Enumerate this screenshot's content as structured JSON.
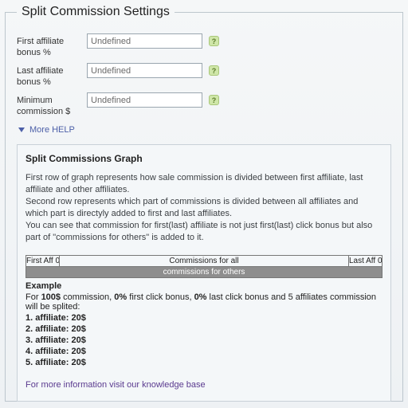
{
  "legend": "Split Commission Settings",
  "rows": {
    "first": {
      "label": "First affiliate bonus %",
      "value": "Undefined"
    },
    "last": {
      "label": "Last affiliate bonus %",
      "value": "Undefined"
    },
    "min": {
      "label": "Minimum commission $",
      "value": "Undefined"
    }
  },
  "help": {
    "more": "More HELP"
  },
  "panel": {
    "title": "Split Commissions Graph",
    "p1": "First row of graph represents how sale commission is divided between first affiliate, last affiliate and other affiliates.",
    "p2": "Second row represents which part of commissions is divided between all affiliates and which part is directyly added to first and last affiliates.",
    "p3": "You can see that commission for first(last) affiliate is not just first(last) click bonus but also part of \"commissions for others\" is added to it.",
    "table": {
      "c1": "First Aff 0",
      "c2": "Commissions for all",
      "c3": "Last Aff 0",
      "c4": "commissions for others"
    },
    "example": "Example",
    "exline_a": "For ",
    "exline_b": "100$",
    "exline_c": " commission, ",
    "exline_d": "0%",
    "exline_e": " first click bonus, ",
    "exline_f": "0%",
    "exline_g": " last click bonus and 5 affiliates commission will be splited:",
    "aff": [
      {
        "n": "1.",
        "t": " affiliate: ",
        "v": "20$"
      },
      {
        "n": "2.",
        "t": " affiliate: ",
        "v": "20$"
      },
      {
        "n": "3.",
        "t": " affiliate: ",
        "v": "20$"
      },
      {
        "n": "4.",
        "t": " affiliate: ",
        "v": "20$"
      },
      {
        "n": "5.",
        "t": " affiliate: ",
        "v": "20$"
      }
    ],
    "kb": "For more information visit our knowledge base"
  }
}
